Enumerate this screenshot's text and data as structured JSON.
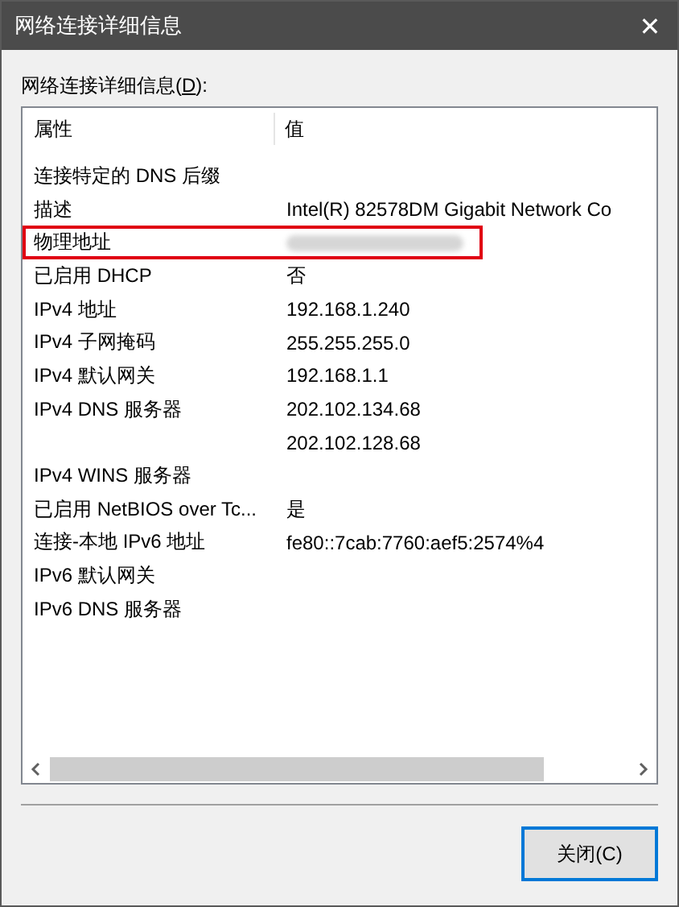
{
  "window": {
    "title": "网络连接详细信息",
    "close": "✕"
  },
  "list_label": "网络连接详细信息(**D**):",
  "table": {
    "columns": [
      "属性",
      "值"
    ],
    "rows": [
      {
        "property": "连接特定的 DNS 后缀",
        "value": "",
        "highlighted": false,
        "redacted": false
      },
      {
        "property": "描述",
        "value": "Intel(R) 82578DM Gigabit Network Co",
        "highlighted": false,
        "redacted": false
      },
      {
        "property": "物理地址",
        "value": "",
        "highlighted": true,
        "redacted": true
      },
      {
        "property": "已启用 DHCP",
        "value": "否",
        "highlighted": false,
        "redacted": false
      },
      {
        "property": "IPv4 地址",
        "value": "192.168.1.240",
        "highlighted": false,
        "redacted": false
      },
      {
        "property": "IPv4 子网掩码",
        "value": "255.255.255.0",
        "highlighted": false,
        "redacted": false
      },
      {
        "property": "IPv4 默认网关",
        "value": "192.168.1.1",
        "highlighted": false,
        "redacted": false
      },
      {
        "property": "IPv4 DNS 服务器",
        "value": "202.102.134.68",
        "highlighted": false,
        "redacted": false
      },
      {
        "property": "",
        "value": "202.102.128.68",
        "highlighted": false,
        "redacted": false
      },
      {
        "property": "IPv4 WINS 服务器",
        "value": "",
        "highlighted": false,
        "redacted": false
      },
      {
        "property": "已启用 NetBIOS over Tc...",
        "value": "是",
        "highlighted": false,
        "redacted": false
      },
      {
        "property": "连接-本地 IPv6 地址",
        "value": "fe80::7cab:7760:aef5:2574%4",
        "highlighted": false,
        "redacted": false
      },
      {
        "property": "IPv6 默认网关",
        "value": "",
        "highlighted": false,
        "redacted": false
      },
      {
        "property": "IPv6 DNS 服务器",
        "value": "",
        "highlighted": false,
        "redacted": false
      }
    ]
  },
  "buttons": [
    {
      "label": "关闭(C)",
      "focused": true
    }
  ]
}
